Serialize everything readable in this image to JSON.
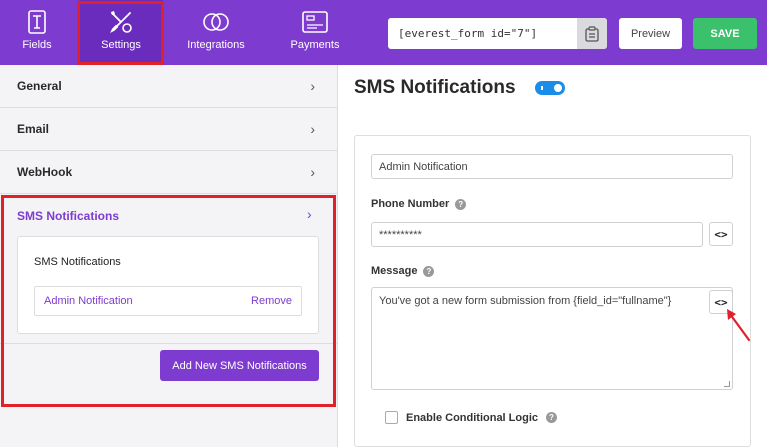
{
  "topbar": {
    "nav": [
      {
        "label": "Fields",
        "icon": "fields-icon"
      },
      {
        "label": "Settings",
        "icon": "settings-icon"
      },
      {
        "label": "Integrations",
        "icon": "integrations-icon"
      },
      {
        "label": "Payments",
        "icon": "payments-icon"
      }
    ],
    "shortcode": "[everest_form id=\"7\"]",
    "preview_label": "Preview",
    "save_label": "SAVE"
  },
  "sidebar": {
    "items": [
      {
        "label": "General"
      },
      {
        "label": "Email"
      },
      {
        "label": "WebHook"
      }
    ],
    "sms": {
      "header": "SMS Notifications",
      "inner_title": "SMS Notifications",
      "row_name": "Admin Notification",
      "row_action": "Remove"
    },
    "add_button": "Add New SMS Notifications"
  },
  "main": {
    "title": "SMS Notifications",
    "toggle_on": true,
    "notification_name": "Admin Notification",
    "phone_label": "Phone Number",
    "phone_value": "**********",
    "message_label": "Message",
    "message_value": "You've got a new form submission from {field_id=\"fullname\"}",
    "code_button": "<>",
    "conditional_label": "Enable Conditional Logic",
    "help_glyph": "?"
  },
  "colors": {
    "brand_purple": "#7e3bd0",
    "save_green": "#3bc16b",
    "toggle_blue": "#1a8dea",
    "highlight_red": "#e0202b"
  }
}
